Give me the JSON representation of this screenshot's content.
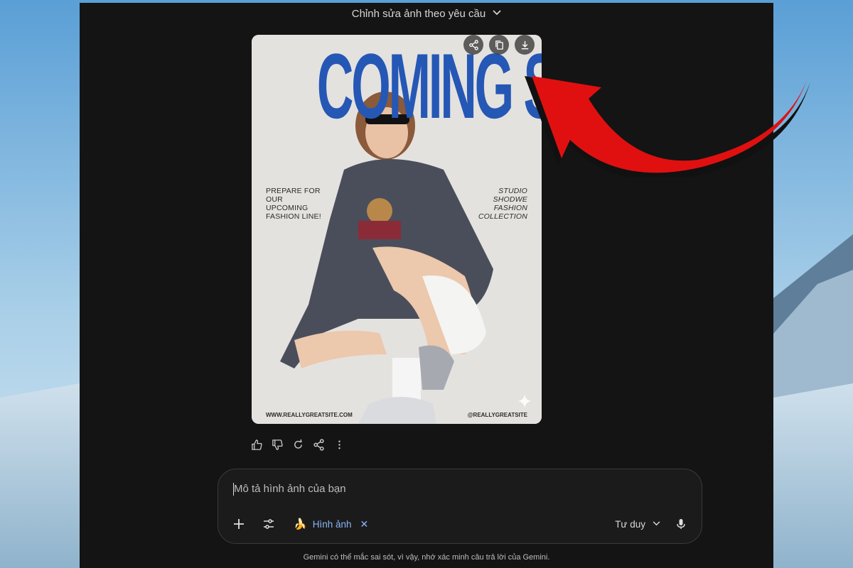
{
  "header": {
    "title": "Chỉnh sửa ảnh theo yêu cầu"
  },
  "poster": {
    "headline": "COMING SOON",
    "left_lines": [
      "PREPARE FOR",
      "OUR",
      "UPCOMING",
      "FASHION LINE!"
    ],
    "right_lines": [
      "STUDIO",
      "SHODWE",
      "FASHION",
      "COLLECTION"
    ],
    "footer_left": "WWW.REALLYGREATSITE.COM",
    "footer_right": "@REALLYGREATSITE"
  },
  "image_actions": [
    "share-icon",
    "copy-icon",
    "download-icon"
  ],
  "feedback_icons": [
    "thumbs-up-icon",
    "thumbs-down-icon",
    "redo-icon",
    "share-icon",
    "more-icon"
  ],
  "input": {
    "placeholder": "Mô tả hình ảnh của bạn"
  },
  "tools": {
    "chip_emoji": "🍌",
    "chip_label": "Hình ảnh",
    "chip_close": "✕",
    "mode_label": "Tư duy"
  },
  "footer": {
    "disclaimer": "Gemini có thể mắc sai sót, vì vậy, nhớ xác minh câu trả lời của Gemini."
  },
  "colors": {
    "panel": "#141414",
    "accent": "#8ab4f8",
    "poster_blue": "#2557b5",
    "arrow": "#e01010"
  }
}
